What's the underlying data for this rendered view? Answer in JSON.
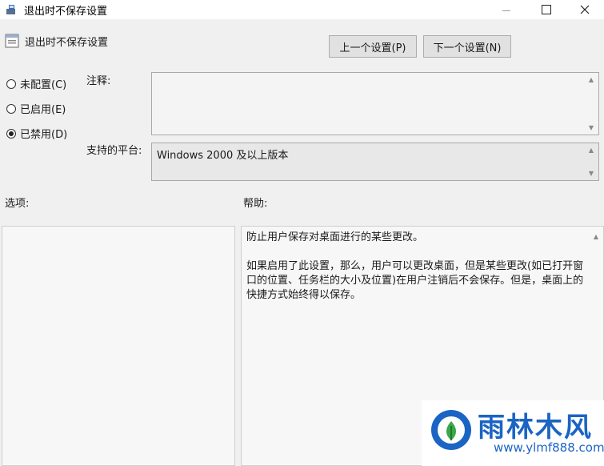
{
  "window": {
    "title": "退出时不保存设置",
    "controls": [
      "minimize",
      "maximize",
      "close"
    ]
  },
  "header": {
    "setting_name": "退出时不保存设置",
    "prev_button": "上一个设置(P)",
    "next_button": "下一个设置(N)"
  },
  "state_options": [
    {
      "label": "未配置(C)",
      "checked": false
    },
    {
      "label": "已启用(E)",
      "checked": false
    },
    {
      "label": "已禁用(D)",
      "checked": true
    }
  ],
  "comment": {
    "label": "注释:",
    "value": ""
  },
  "platform": {
    "label": "支持的平台:",
    "value": "Windows 2000 及以上版本"
  },
  "options": {
    "label": "选项:"
  },
  "help": {
    "label": "帮助:",
    "paragraph1": "防止用户保存对桌面进行的某些更改。",
    "paragraph2": "如果启用了此设置，那么，用户可以更改桌面，但是某些更改(如已打开窗口的位置、任务栏的大小及位置)在用户注销后不会保存。但是，桌面上的快捷方式始终得以保存。"
  },
  "watermark": {
    "brand": "雨林木风",
    "url": "www.ylmf888.com"
  },
  "colors": {
    "accent": "#1a64c4",
    "window_bg": "#f0f0f0"
  }
}
